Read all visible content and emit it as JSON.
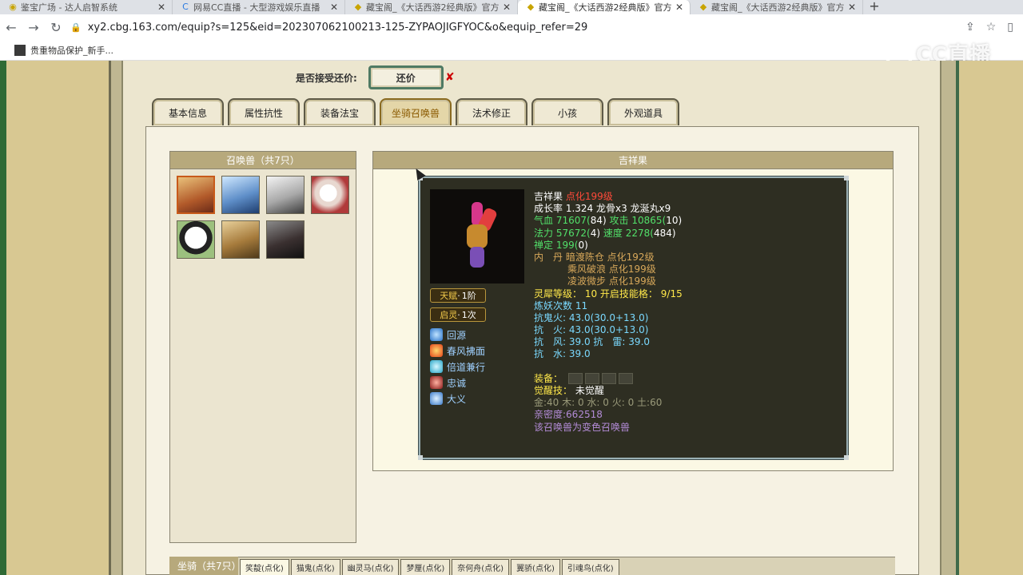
{
  "browser": {
    "tabs": [
      {
        "label": "鉴宝广场 - 达人启智系统",
        "favicon": "globe-icon",
        "active": false
      },
      {
        "label": "网易CC直播 - 大型游戏娱乐直播",
        "favicon": "cc-icon",
        "active": false
      },
      {
        "label": "藏宝阁_《大话西游2经典版》官方",
        "favicon": "cbg-icon",
        "active": false
      },
      {
        "label": "藏宝阁_《大话西游2经典版》官方",
        "favicon": "cbg-icon",
        "active": true
      },
      {
        "label": "藏宝阁_《大话西游2经典版》官方",
        "favicon": "cbg-icon",
        "active": false
      }
    ],
    "url": "xy2.cbg.163.com/equip?s=125&eid=202307062100213-125-ZYPAOJIGFYOC&o&equip_refer=29",
    "bookmark": "贵重物品保护_新手..."
  },
  "watermark": "CC直播",
  "counter_offer": {
    "label": "是否接受还价:",
    "button": "还价",
    "mark": "✘"
  },
  "tabs": [
    {
      "label": "基本信息",
      "active": false
    },
    {
      "label": "属性抗性",
      "active": false
    },
    {
      "label": "装备法宝",
      "active": false
    },
    {
      "label": "坐骑召唤兽",
      "active": true
    },
    {
      "label": "法术修正",
      "active": false
    },
    {
      "label": "小孩",
      "active": false
    },
    {
      "label": "外观道具",
      "active": false
    }
  ],
  "summons": {
    "title": "召唤兽（共7只）"
  },
  "detail": {
    "title": "吉祥果",
    "badges": [
      {
        "label": "天赋",
        "value": "1阶"
      },
      {
        "label": "启灵",
        "value": "1次"
      }
    ],
    "skills": [
      "回源",
      "春风拂面",
      "倍道兼行",
      "忠诚",
      "大义"
    ],
    "stats": {
      "name": "吉祥果",
      "name_tag": "点化199级",
      "growth": "成长率 1.324 龙骨x3 龙涎丸x9",
      "hp_label": "气血",
      "hp": "71607(",
      "hp_extra": "84",
      "hp_close": ")",
      "atk_label": "攻击",
      "atk": "10865(",
      "atk_extra": "10",
      "atk_close": ")",
      "mp_label": "法力",
      "mp": "57672(",
      "mp_extra": "4",
      "mp_close": ")",
      "spd_label": "速度",
      "spd": "2278(",
      "spd_extra": "484",
      "spd_close": ")",
      "zen_label": "禅定",
      "zen": "199(",
      "zen_extra": "0",
      "zen_close": ")",
      "inner_label": "内　丹",
      "inner1": "暗渡陈仓 点化192级",
      "inner2": "乘风破浪 点化199级",
      "inner3": "凌波微步 点化199级",
      "soul_label": "灵犀等级：",
      "soul": "10 开启技能格：",
      "soul_slots": "9/15",
      "refine": "炼妖次数 11",
      "res1_label": "抗鬼火:",
      "res1": "43.0(30.0+13.0)",
      "res2_label": "抗　火:",
      "res2": "43.0(30.0+13.0)",
      "res3_label": "抗　风:",
      "res3": "39.0",
      "res3b_label": "抗　雷:",
      "res3b": "39.0",
      "res4_label": "抗　水:",
      "res4": "39.0",
      "equip_label": "装备：",
      "awaken_label": "觉醒技：",
      "awaken": "未觉醒",
      "elements": "金:40 木: 0 水: 0 火: 0 土:60",
      "intimacy": "亲密度:662518",
      "note": "该召唤兽为变色召唤兽"
    }
  },
  "mounts": {
    "title": "坐骑（共7只）",
    "tabs": [
      "笑靛(点化)",
      "猫鬼(点化)",
      "幽灵马(点化)",
      "梦厘(点化)",
      "奈何舟(点化)",
      "翼骄(点化)",
      "引魂鸟(点化)"
    ]
  },
  "colors": {
    "accent": "#4f7a63",
    "header": "#b7a97c",
    "card_bg": "#2e2e22"
  }
}
